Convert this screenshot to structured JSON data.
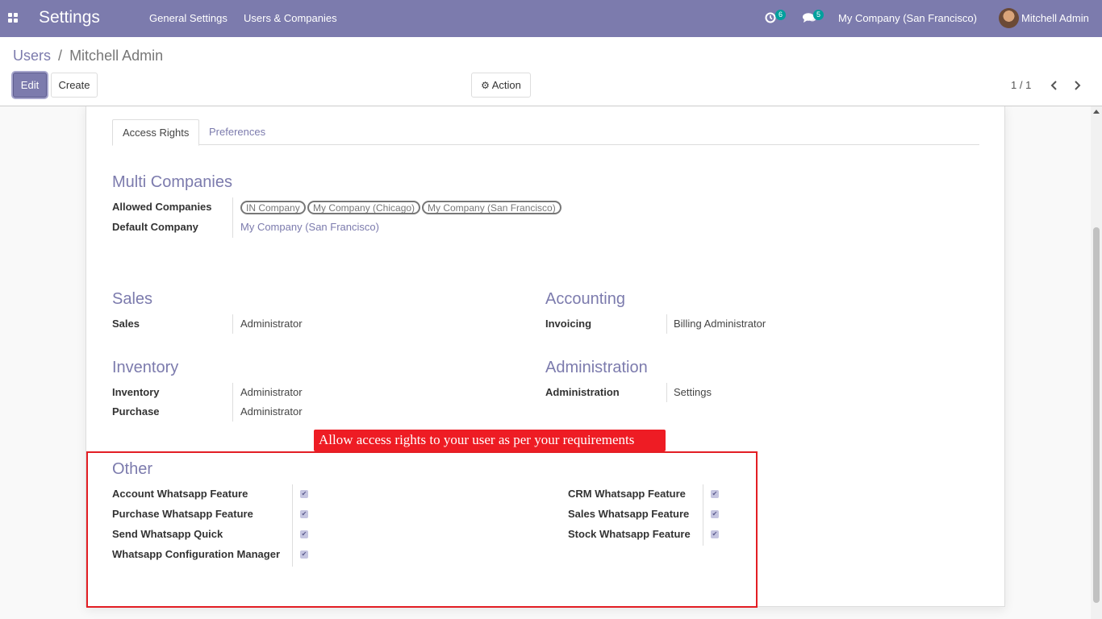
{
  "navbar": {
    "app_title": "Settings",
    "menu": [
      "General Settings",
      "Users & Companies"
    ],
    "activity_count": "6",
    "message_count": "5",
    "company": "My Company (San Francisco)",
    "user": "Mitchell Admin"
  },
  "breadcrumb": {
    "parent": "Users",
    "separator": "/",
    "current": "Mitchell Admin"
  },
  "toolbar": {
    "edit_label": "Edit",
    "create_label": "Create",
    "action_label": "Action",
    "pager": "1 / 1"
  },
  "tabs": [
    "Access Rights",
    "Preferences"
  ],
  "multi_companies": {
    "title": "Multi Companies",
    "allowed_label": "Allowed Companies",
    "allowed_tags": [
      "IN Company",
      "My Company (Chicago)",
      "My Company (San Francisco)"
    ],
    "default_label": "Default Company",
    "default_value": "My Company (San Francisco)"
  },
  "sales": {
    "title": "Sales",
    "rows": [
      {
        "label": "Sales",
        "value": "Administrator"
      }
    ]
  },
  "accounting": {
    "title": "Accounting",
    "rows": [
      {
        "label": "Invoicing",
        "value": "Billing Administrator"
      }
    ]
  },
  "inventory": {
    "title": "Inventory",
    "rows": [
      {
        "label": "Inventory",
        "value": "Administrator"
      },
      {
        "label": "Purchase",
        "value": "Administrator"
      }
    ]
  },
  "administration": {
    "title": "Administration",
    "rows": [
      {
        "label": "Administration",
        "value": "Settings"
      }
    ]
  },
  "other": {
    "title": "Other",
    "left": [
      {
        "label": "Account Whatsapp Feature",
        "checked": true
      },
      {
        "label": "Purchase Whatsapp Feature",
        "checked": true
      },
      {
        "label": "Send Whatsapp Quick",
        "checked": true
      },
      {
        "label": "Whatsapp Configuration Manager",
        "checked": true
      }
    ],
    "right": [
      {
        "label": "CRM Whatsapp Feature",
        "checked": true
      },
      {
        "label": "Sales Whatsapp Feature",
        "checked": true
      },
      {
        "label": "Stock Whatsapp Feature",
        "checked": true
      }
    ]
  },
  "annotation": "Allow access rights to your user as per your requirements",
  "colors": {
    "navbar": "#7c7bad",
    "accent": "#7c7bad",
    "annotation_red": "#e31e24"
  },
  "icons": [
    "apps-grid-icon",
    "activity-clock-icon",
    "chat-icon",
    "gear-icon",
    "chevron-left-icon",
    "chevron-right-icon",
    "check-icon"
  ]
}
